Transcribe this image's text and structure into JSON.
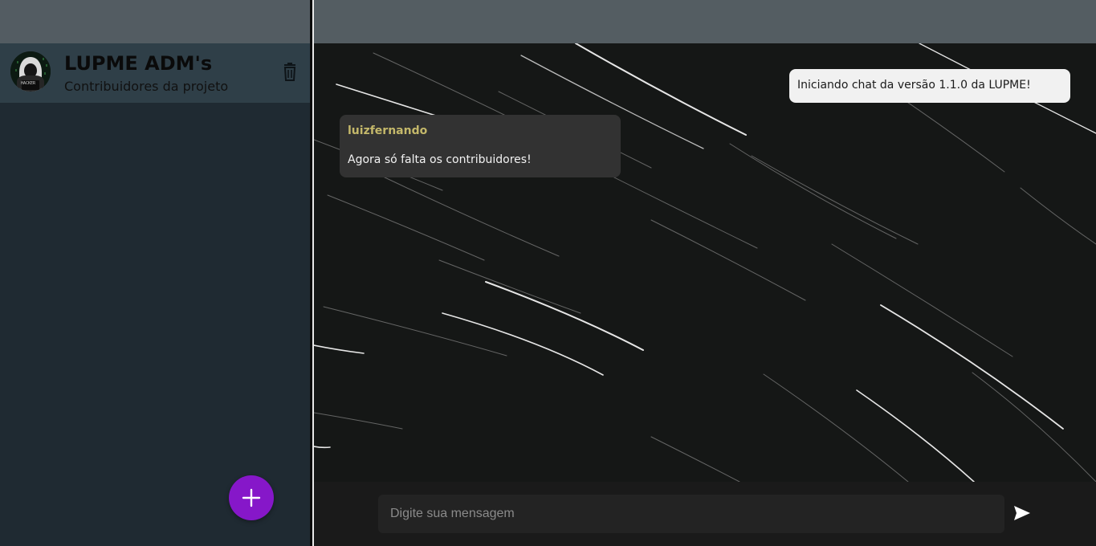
{
  "sidebar": {
    "chats": [
      {
        "title": "LUPME ADM's",
        "subtitle": "Contribuidores da projeto",
        "avatar_icon": "hacker-avatar",
        "avatar_label": "HACKER"
      }
    ],
    "fab_icon": "plus-icon",
    "fab_color": "#8617c9"
  },
  "chat": {
    "messages": [
      {
        "type": "system",
        "text": "Iniciando chat da versão 1.1.0 da LUPME!"
      },
      {
        "type": "user",
        "author": "luizfernando",
        "text": "Agora só falta os contribuidores!"
      }
    ],
    "background": "star-trails"
  },
  "composer": {
    "placeholder": "Digite sua mensagem",
    "value": "",
    "send_icon": "send-icon"
  },
  "colors": {
    "header": "#545d62",
    "sidebar": "#1f2a32",
    "chat_item": "#2f3f48",
    "author": "#c4b86a",
    "accent": "#8617c9"
  }
}
